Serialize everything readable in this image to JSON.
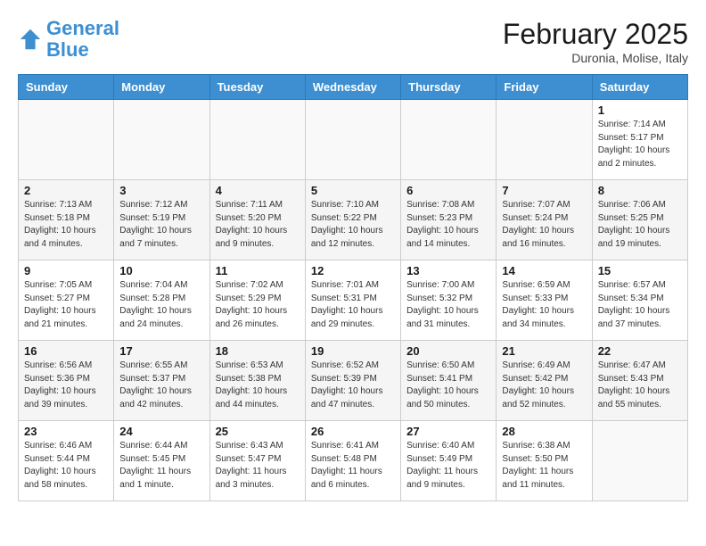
{
  "header": {
    "logo_general": "General",
    "logo_blue": "Blue",
    "month_title": "February 2025",
    "subtitle": "Duronia, Molise, Italy"
  },
  "days_of_week": [
    "Sunday",
    "Monday",
    "Tuesday",
    "Wednesday",
    "Thursday",
    "Friday",
    "Saturday"
  ],
  "weeks": [
    [
      {
        "day": "",
        "info": ""
      },
      {
        "day": "",
        "info": ""
      },
      {
        "day": "",
        "info": ""
      },
      {
        "day": "",
        "info": ""
      },
      {
        "day": "",
        "info": ""
      },
      {
        "day": "",
        "info": ""
      },
      {
        "day": "1",
        "info": "Sunrise: 7:14 AM\nSunset: 5:17 PM\nDaylight: 10 hours and 2 minutes."
      }
    ],
    [
      {
        "day": "2",
        "info": "Sunrise: 7:13 AM\nSunset: 5:18 PM\nDaylight: 10 hours and 4 minutes."
      },
      {
        "day": "3",
        "info": "Sunrise: 7:12 AM\nSunset: 5:19 PM\nDaylight: 10 hours and 7 minutes."
      },
      {
        "day": "4",
        "info": "Sunrise: 7:11 AM\nSunset: 5:20 PM\nDaylight: 10 hours and 9 minutes."
      },
      {
        "day": "5",
        "info": "Sunrise: 7:10 AM\nSunset: 5:22 PM\nDaylight: 10 hours and 12 minutes."
      },
      {
        "day": "6",
        "info": "Sunrise: 7:08 AM\nSunset: 5:23 PM\nDaylight: 10 hours and 14 minutes."
      },
      {
        "day": "7",
        "info": "Sunrise: 7:07 AM\nSunset: 5:24 PM\nDaylight: 10 hours and 16 minutes."
      },
      {
        "day": "8",
        "info": "Sunrise: 7:06 AM\nSunset: 5:25 PM\nDaylight: 10 hours and 19 minutes."
      }
    ],
    [
      {
        "day": "9",
        "info": "Sunrise: 7:05 AM\nSunset: 5:27 PM\nDaylight: 10 hours and 21 minutes."
      },
      {
        "day": "10",
        "info": "Sunrise: 7:04 AM\nSunset: 5:28 PM\nDaylight: 10 hours and 24 minutes."
      },
      {
        "day": "11",
        "info": "Sunrise: 7:02 AM\nSunset: 5:29 PM\nDaylight: 10 hours and 26 minutes."
      },
      {
        "day": "12",
        "info": "Sunrise: 7:01 AM\nSunset: 5:31 PM\nDaylight: 10 hours and 29 minutes."
      },
      {
        "day": "13",
        "info": "Sunrise: 7:00 AM\nSunset: 5:32 PM\nDaylight: 10 hours and 31 minutes."
      },
      {
        "day": "14",
        "info": "Sunrise: 6:59 AM\nSunset: 5:33 PM\nDaylight: 10 hours and 34 minutes."
      },
      {
        "day": "15",
        "info": "Sunrise: 6:57 AM\nSunset: 5:34 PM\nDaylight: 10 hours and 37 minutes."
      }
    ],
    [
      {
        "day": "16",
        "info": "Sunrise: 6:56 AM\nSunset: 5:36 PM\nDaylight: 10 hours and 39 minutes."
      },
      {
        "day": "17",
        "info": "Sunrise: 6:55 AM\nSunset: 5:37 PM\nDaylight: 10 hours and 42 minutes."
      },
      {
        "day": "18",
        "info": "Sunrise: 6:53 AM\nSunset: 5:38 PM\nDaylight: 10 hours and 44 minutes."
      },
      {
        "day": "19",
        "info": "Sunrise: 6:52 AM\nSunset: 5:39 PM\nDaylight: 10 hours and 47 minutes."
      },
      {
        "day": "20",
        "info": "Sunrise: 6:50 AM\nSunset: 5:41 PM\nDaylight: 10 hours and 50 minutes."
      },
      {
        "day": "21",
        "info": "Sunrise: 6:49 AM\nSunset: 5:42 PM\nDaylight: 10 hours and 52 minutes."
      },
      {
        "day": "22",
        "info": "Sunrise: 6:47 AM\nSunset: 5:43 PM\nDaylight: 10 hours and 55 minutes."
      }
    ],
    [
      {
        "day": "23",
        "info": "Sunrise: 6:46 AM\nSunset: 5:44 PM\nDaylight: 10 hours and 58 minutes."
      },
      {
        "day": "24",
        "info": "Sunrise: 6:44 AM\nSunset: 5:45 PM\nDaylight: 11 hours and 1 minute."
      },
      {
        "day": "25",
        "info": "Sunrise: 6:43 AM\nSunset: 5:47 PM\nDaylight: 11 hours and 3 minutes."
      },
      {
        "day": "26",
        "info": "Sunrise: 6:41 AM\nSunset: 5:48 PM\nDaylight: 11 hours and 6 minutes."
      },
      {
        "day": "27",
        "info": "Sunrise: 6:40 AM\nSunset: 5:49 PM\nDaylight: 11 hours and 9 minutes."
      },
      {
        "day": "28",
        "info": "Sunrise: 6:38 AM\nSunset: 5:50 PM\nDaylight: 11 hours and 11 minutes."
      },
      {
        "day": "",
        "info": ""
      }
    ]
  ]
}
